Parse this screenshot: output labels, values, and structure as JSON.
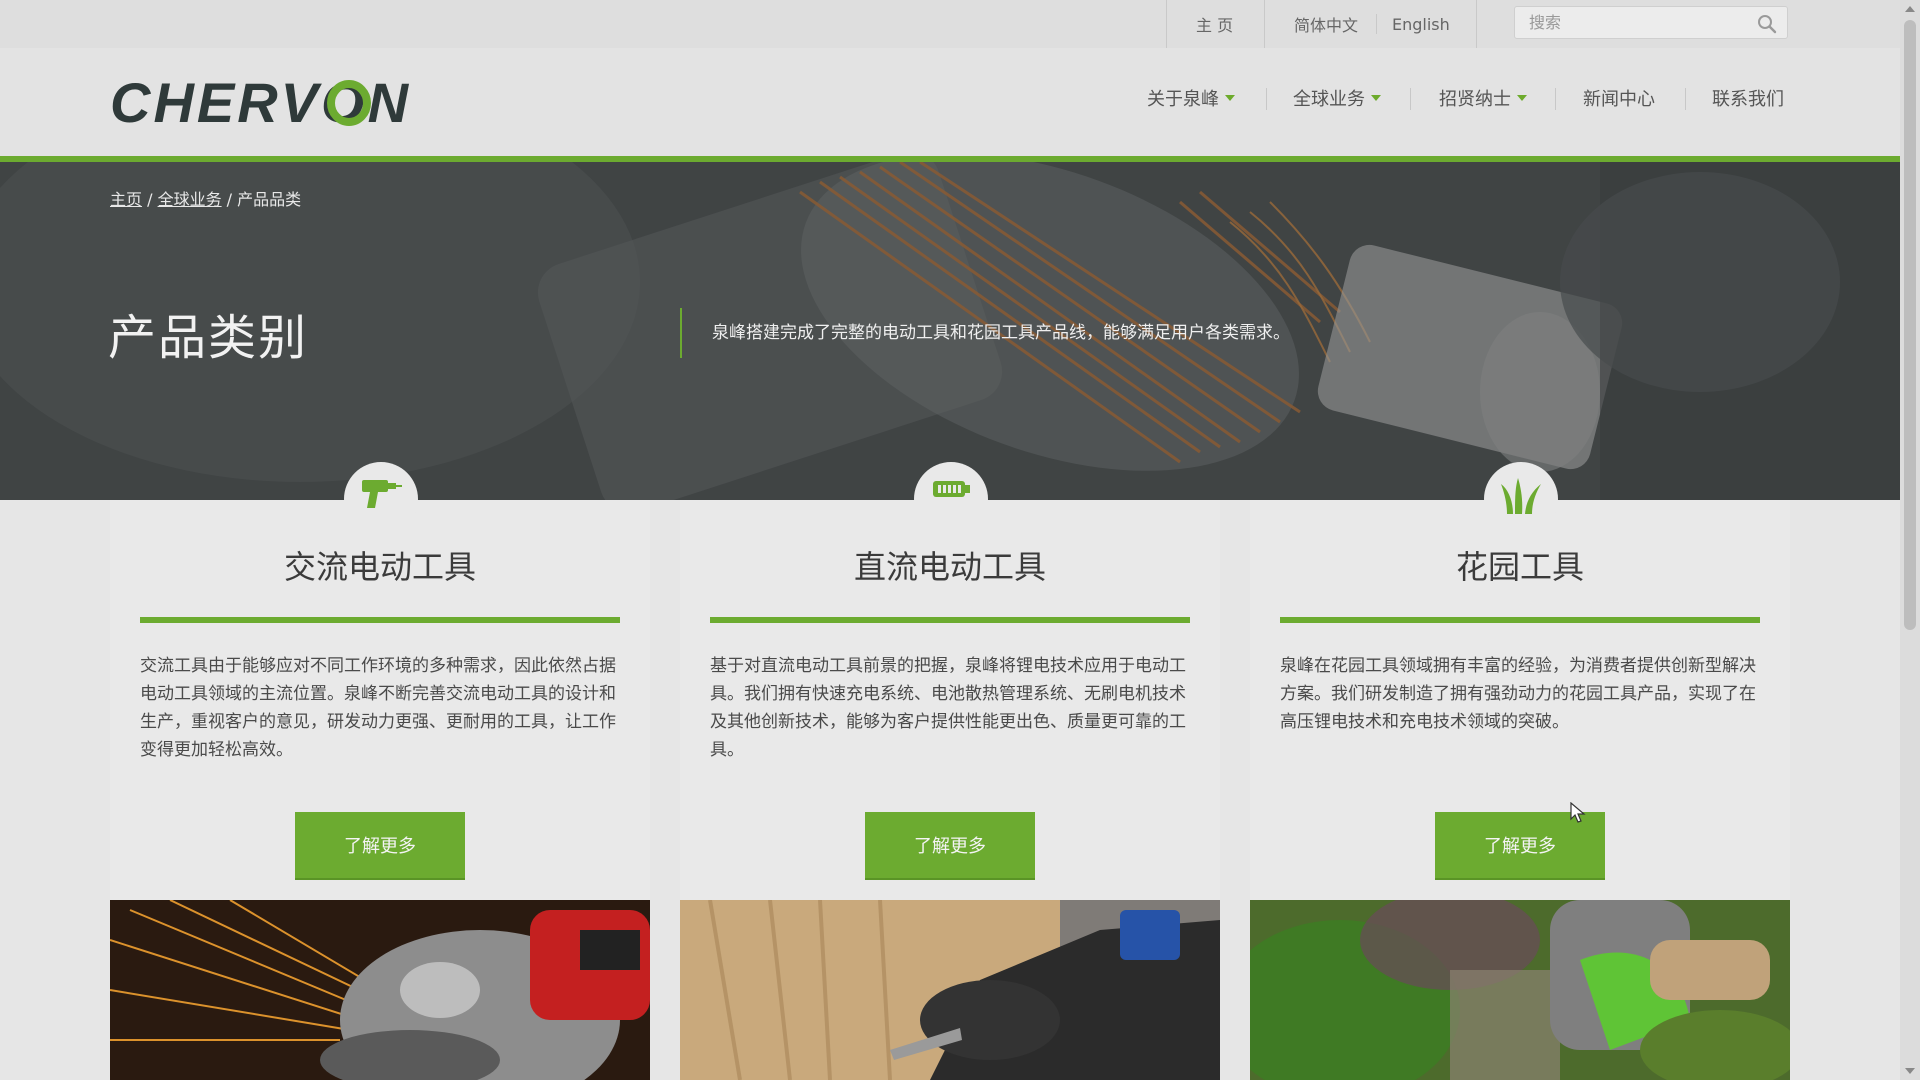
{
  "topbar": {
    "home": "主 页",
    "lang_zh": "简体中文",
    "lang_en": "English",
    "search_placeholder": "搜索"
  },
  "header": {
    "logo_text": "CHERVON",
    "nav": [
      {
        "label": "关于泉峰",
        "has_dropdown": true
      },
      {
        "label": "全球业务",
        "has_dropdown": true
      },
      {
        "label": "招贤纳士",
        "has_dropdown": true
      },
      {
        "label": "新闻中心",
        "has_dropdown": false
      },
      {
        "label": "联系我们",
        "has_dropdown": false
      }
    ]
  },
  "breadcrumb": {
    "home": "主页",
    "sep1": " / ",
    "business": "全球业务",
    "sep2": " / ",
    "current": "产品品类"
  },
  "hero": {
    "title": "产品类别",
    "description": "泉峰搭建完成了完整的电动工具和花园工具产品线，能够满足用户各类需求。"
  },
  "cards": [
    {
      "icon": "drill-icon",
      "title": "交流电动工具",
      "text": "交流工具由于能够应对不同工作环境的多种需求，因此依然占据电动工具领域的主流位置。泉峰不断完善交流电动工具的设计和生产，重视客户的意见，研发动力更强、更耐用的工具，让工作变得更加轻松高效。",
      "button": "了解更多",
      "photo": "angle-grinder-photo"
    },
    {
      "icon": "battery-icon",
      "title": "直流电动工具",
      "text": "基于对直流电动工具前景的把握，泉峰将锂电技术应用于电动工具。我们拥有快速充电系统、电池散热管理系统、无刷电机技术及其他创新技术，能够为客户提供性能更出色、质量更可靠的工具。",
      "button": "了解更多",
      "photo": "cordless-drill-photo"
    },
    {
      "icon": "grass-icon",
      "title": "花园工具",
      "text": "泉峰在花园工具领域拥有丰富的经验，为消费者提供创新型解决方案。我们研发制造了拥有强劲动力的花园工具产品，实现了在高压锂电技术和充电技术领域的突破。",
      "button": "了解更多",
      "photo": "hedge-trimmer-photo"
    }
  ],
  "colors": {
    "brand_green": "#6cab30",
    "logo_dark": "#2f3a3a"
  }
}
